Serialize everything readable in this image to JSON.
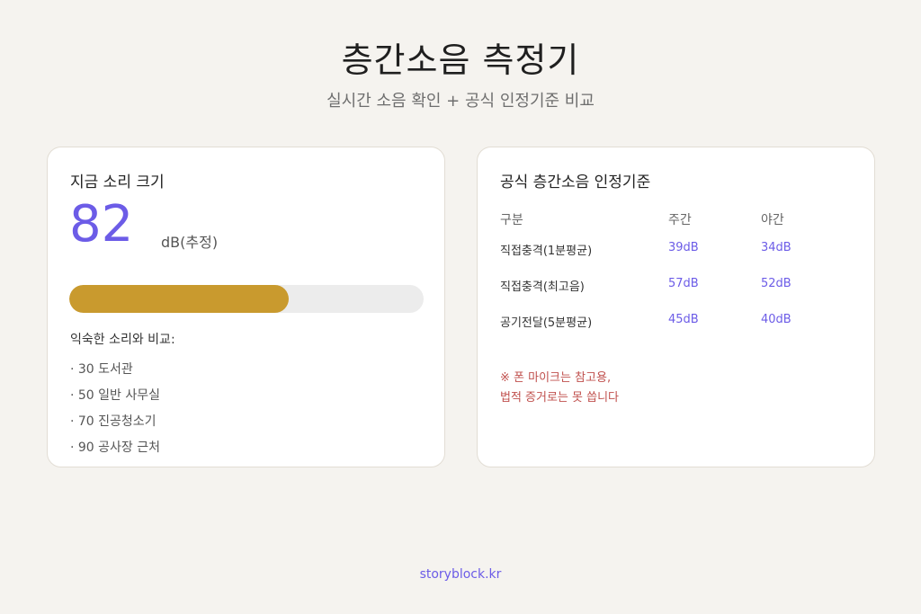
{
  "header": {
    "title": "층간소음 측정기",
    "subtitle": "실시간 소음 확인 + 공식 인정기준 비교"
  },
  "meter_card": {
    "heading": "지금 소리 크기",
    "value": "82",
    "unit": "dB(추정)",
    "level_fraction": 0.62,
    "compare_title": "익숙한 소리와 비교:",
    "compare_items": [
      "· 30 도서관",
      "· 50 일반 사무실",
      "· 70 진공청소기",
      "· 90 공사장 근처"
    ]
  },
  "standards_card": {
    "heading": "공식 층간소음 인정기준",
    "columns": [
      "구분",
      "주간",
      "야간"
    ],
    "rows": [
      [
        "직접충격(1분평균)",
        "39dB",
        "34dB"
      ],
      [
        "직접충격(최고음)",
        "57dB",
        "52dB"
      ],
      [
        "공기전달(5분평균)",
        "45dB",
        "40dB"
      ]
    ],
    "note_line1": "※ 폰 마이크는 참고용,",
    "note_line2": "법적 증거로는 못 씁니다"
  },
  "footer": {
    "link": "storyblock.kr"
  },
  "colors": {
    "accent": "#6c5ce7",
    "meter_fill": "#c99a2e",
    "warning": "#c0504d",
    "background": "#f5f3ef"
  }
}
